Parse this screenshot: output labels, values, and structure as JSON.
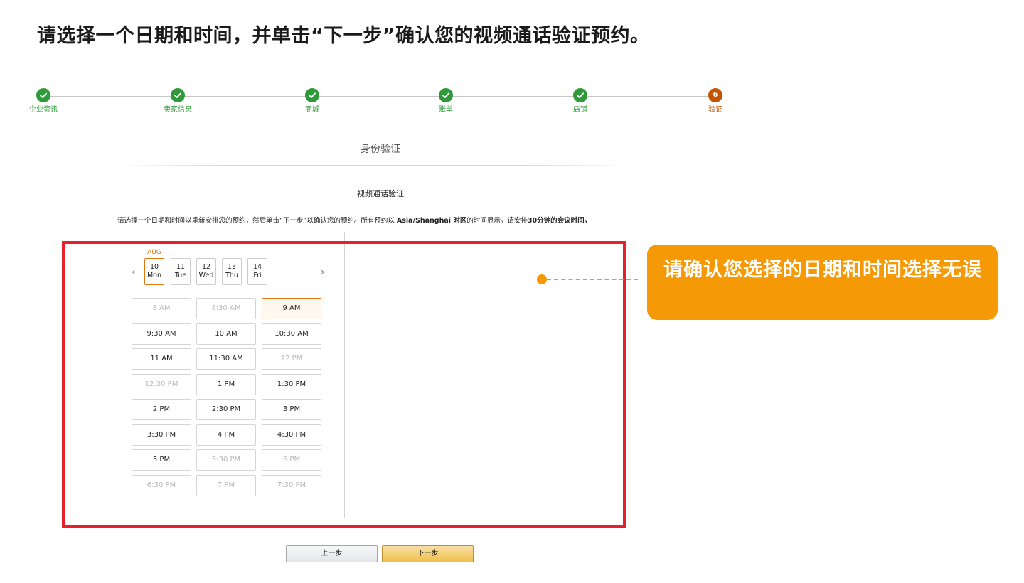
{
  "headline": "请选择一个日期和时间，并单击“下一步”确认您的视频通话验证预约。",
  "stepper": {
    "steps": [
      {
        "label": "企业资讯",
        "status": "done"
      },
      {
        "label": "卖家信息",
        "status": "done"
      },
      {
        "label": "商城",
        "status": "done"
      },
      {
        "label": "账单",
        "status": "done"
      },
      {
        "label": "店铺",
        "status": "done"
      },
      {
        "label": "验证",
        "status": "current",
        "number": "6"
      }
    ]
  },
  "section_title": "身份验证",
  "sub_title": "视频通话验证",
  "instruction": {
    "part1": "请选择一个日期和时间以重新安排您的预约，然后单击“下一步”以确认您的预约。所有预约以 ",
    "timezone": "Asia/Shanghai 时区",
    "part2": "的时间显示。请安排",
    "duration": "30分钟的会议时间。"
  },
  "scheduler": {
    "month": "AUG",
    "prev_icon": "chevron-left-icon",
    "next_icon": "chevron-right-icon",
    "prev_glyph": "‹",
    "next_glyph": "›",
    "days": [
      {
        "date": "10",
        "weekday": "Mon",
        "selected": true
      },
      {
        "date": "11",
        "weekday": "Tue",
        "selected": false
      },
      {
        "date": "12",
        "weekday": "Wed",
        "selected": false
      },
      {
        "date": "13",
        "weekday": "Thu",
        "selected": false
      },
      {
        "date": "14",
        "weekday": "Fri",
        "selected": false
      }
    ],
    "slots": [
      {
        "label": "8 AM",
        "state": "disabled"
      },
      {
        "label": "8:30 AM",
        "state": "disabled"
      },
      {
        "label": "9 AM",
        "state": "selected"
      },
      {
        "label": "9:30 AM",
        "state": "available"
      },
      {
        "label": "10 AM",
        "state": "available"
      },
      {
        "label": "10:30 AM",
        "state": "available"
      },
      {
        "label": "11 AM",
        "state": "available"
      },
      {
        "label": "11:30 AM",
        "state": "available"
      },
      {
        "label": "12 PM",
        "state": "disabled"
      },
      {
        "label": "12:30 PM",
        "state": "disabled"
      },
      {
        "label": "1 PM",
        "state": "available"
      },
      {
        "label": "1:30 PM",
        "state": "available"
      },
      {
        "label": "2 PM",
        "state": "available"
      },
      {
        "label": "2:30 PM",
        "state": "available"
      },
      {
        "label": "3 PM",
        "state": "available"
      },
      {
        "label": "3:30 PM",
        "state": "available"
      },
      {
        "label": "4 PM",
        "state": "available"
      },
      {
        "label": "4:30 PM",
        "state": "available"
      },
      {
        "label": "5 PM",
        "state": "available"
      },
      {
        "label": "5:30 PM",
        "state": "disabled"
      },
      {
        "label": "6 PM",
        "state": "disabled"
      },
      {
        "label": "6:30 PM",
        "state": "disabled"
      },
      {
        "label": "7 PM",
        "state": "disabled"
      },
      {
        "label": "7:30 PM",
        "state": "disabled"
      }
    ]
  },
  "callout": {
    "text": "请确认您选择的日期和时间选择无误"
  },
  "buttons": {
    "prev_label": "上一步",
    "next_label": "下一步"
  },
  "colors": {
    "step_done": "#2e9a3a",
    "step_current": "#c45500",
    "highlight_border": "#e8202a",
    "callout_bg": "#f59a06",
    "selection_accent": "#e47911"
  }
}
